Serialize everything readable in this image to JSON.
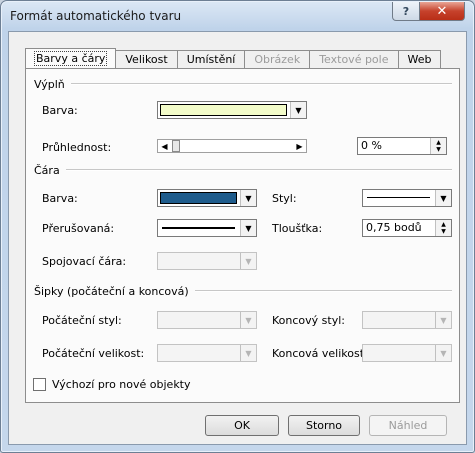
{
  "window": {
    "title": "Formát automatického tvaru",
    "help_label": "?",
    "close_label": "✕"
  },
  "tabs": [
    {
      "label": "Barvy a čáry",
      "state": "active"
    },
    {
      "label": "Velikost",
      "state": "normal"
    },
    {
      "label": "Umístění",
      "state": "normal"
    },
    {
      "label": "Obrázek",
      "state": "disabled"
    },
    {
      "label": "Textové pole",
      "state": "disabled"
    },
    {
      "label": "Web",
      "state": "normal"
    }
  ],
  "fill": {
    "section_label": "Výplň",
    "color_label": "Barva:",
    "color_value": "#f3fcc9",
    "transparency_label": "Průhlednost:",
    "transparency_value": "0 %"
  },
  "line": {
    "section_label": "Čára",
    "color_label": "Barva:",
    "color_value": "#1f5c8c",
    "style_label": "Styl:",
    "dashed_label": "Přerušovaná:",
    "weight_label": "Tloušťka:",
    "weight_value": "0,75 bodů",
    "connector_label": "Spojovací čára:"
  },
  "arrows": {
    "section_label": "Šipky (počáteční a koncová)",
    "begin_style_label": "Počáteční styl:",
    "end_style_label": "Koncový styl:",
    "begin_size_label": "Počáteční velikost:",
    "end_size_label": "Koncová velikost:"
  },
  "default_checkbox_label": "Výchozí pro nové objekty",
  "buttons": {
    "ok": "OK",
    "cancel": "Storno",
    "preview": "Náhled"
  }
}
